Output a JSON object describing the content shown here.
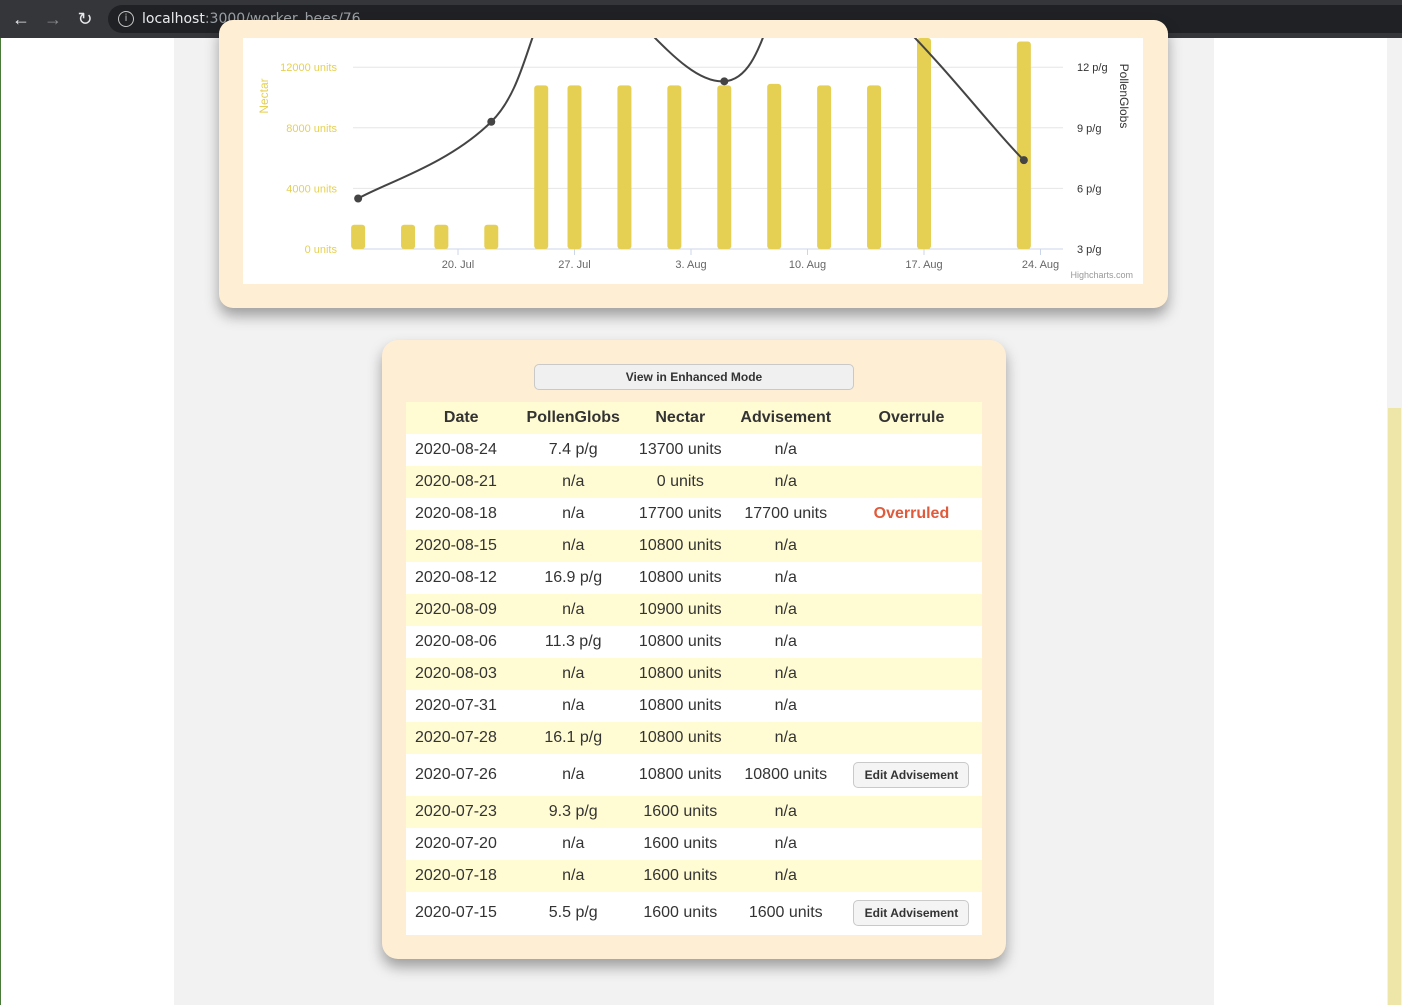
{
  "browser": {
    "url_host": "localhost",
    "url_path": ":3000/worker_bees/76",
    "back_icon": "arrow-left-icon",
    "forward_icon": "arrow-right-icon",
    "reload_icon": "reload-icon",
    "info_icon": "info-icon"
  },
  "colors": {
    "bar": "#e5d053",
    "line": "#444444",
    "nectar_axis": "#e5d053",
    "overruled": "#e05a3c",
    "card": "#feeed3",
    "stripe": "#fffbd2"
  },
  "chart_data": {
    "type": "bar",
    "title": "",
    "credit": "Highcharts.com",
    "x_ticks": [
      "20. Jul",
      "27. Jul",
      "3. Aug",
      "10. Aug",
      "17. Aug",
      "24. Aug"
    ],
    "x_tick_dates": [
      "2020-07-20",
      "2020-07-27",
      "2020-08-03",
      "2020-08-10",
      "2020-08-17",
      "2020-08-24"
    ],
    "left_axis": {
      "title": "Nectar",
      "ticks": [
        "0 units",
        "4000 units",
        "8000 units",
        "12000 units"
      ],
      "tick_values": [
        0,
        4000,
        8000,
        12000
      ]
    },
    "right_axis": {
      "title": "PollenGlobs",
      "ticks": [
        "3 p/g",
        "6 p/g",
        "9 p/g",
        "12 p/g"
      ],
      "tick_values": [
        3,
        6,
        9,
        12
      ]
    },
    "series": [
      {
        "name": "Nectar",
        "type": "column",
        "points": [
          {
            "x": "2020-07-14",
            "y": 1600
          },
          {
            "x": "2020-07-17",
            "y": 1600
          },
          {
            "x": "2020-07-19",
            "y": 1600
          },
          {
            "x": "2020-07-22",
            "y": 1600
          },
          {
            "x": "2020-07-25",
            "y": 10800
          },
          {
            "x": "2020-07-27",
            "y": 10800
          },
          {
            "x": "2020-07-30",
            "y": 10800
          },
          {
            "x": "2020-08-02",
            "y": 10800
          },
          {
            "x": "2020-08-05",
            "y": 10800
          },
          {
            "x": "2020-08-08",
            "y": 10900
          },
          {
            "x": "2020-08-11",
            "y": 10800
          },
          {
            "x": "2020-08-14",
            "y": 10800
          },
          {
            "x": "2020-08-17",
            "y": 17700
          },
          {
            "x": "2020-08-23",
            "y": 13700
          }
        ]
      },
      {
        "name": "PollenGlobs",
        "type": "spline",
        "points": [
          {
            "x": "2020-07-14",
            "y": 5.5
          },
          {
            "x": "2020-07-22",
            "y": 9.3
          },
          {
            "x": "2020-07-27",
            "y": 16.1
          },
          {
            "x": "2020-08-05",
            "y": 11.3
          },
          {
            "x": "2020-08-11",
            "y": 16.9
          },
          {
            "x": "2020-08-23",
            "y": 7.4
          }
        ]
      }
    ]
  },
  "table_card": {
    "enhanced_button": "View in Enhanced Mode",
    "headers": [
      "Date",
      "PollenGlobs",
      "Nectar",
      "Advisement",
      "Overrule"
    ],
    "rows": [
      {
        "date": "2020-08-24",
        "pollen": "7.4 p/g",
        "nectar": "13700 units",
        "advisement": "n/a",
        "overrule": ""
      },
      {
        "date": "2020-08-21",
        "pollen": "n/a",
        "nectar": "0 units",
        "advisement": "n/a",
        "overrule": ""
      },
      {
        "date": "2020-08-18",
        "pollen": "n/a",
        "nectar": "17700 units",
        "advisement": "17700 units",
        "overrule": "Overruled"
      },
      {
        "date": "2020-08-15",
        "pollen": "n/a",
        "nectar": "10800 units",
        "advisement": "n/a",
        "overrule": ""
      },
      {
        "date": "2020-08-12",
        "pollen": "16.9 p/g",
        "nectar": "10800 units",
        "advisement": "n/a",
        "overrule": ""
      },
      {
        "date": "2020-08-09",
        "pollen": "n/a",
        "nectar": "10900 units",
        "advisement": "n/a",
        "overrule": ""
      },
      {
        "date": "2020-08-06",
        "pollen": "11.3 p/g",
        "nectar": "10800 units",
        "advisement": "n/a",
        "overrule": ""
      },
      {
        "date": "2020-08-03",
        "pollen": "n/a",
        "nectar": "10800 units",
        "advisement": "n/a",
        "overrule": ""
      },
      {
        "date": "2020-07-31",
        "pollen": "n/a",
        "nectar": "10800 units",
        "advisement": "n/a",
        "overrule": ""
      },
      {
        "date": "2020-07-28",
        "pollen": "16.1 p/g",
        "nectar": "10800 units",
        "advisement": "n/a",
        "overrule": ""
      },
      {
        "date": "2020-07-26",
        "pollen": "n/a",
        "nectar": "10800 units",
        "advisement": "10800 units",
        "overrule": "Edit Advisement"
      },
      {
        "date": "2020-07-23",
        "pollen": "9.3 p/g",
        "nectar": "1600 units",
        "advisement": "n/a",
        "overrule": ""
      },
      {
        "date": "2020-07-20",
        "pollen": "n/a",
        "nectar": "1600 units",
        "advisement": "n/a",
        "overrule": ""
      },
      {
        "date": "2020-07-18",
        "pollen": "n/a",
        "nectar": "1600 units",
        "advisement": "n/a",
        "overrule": ""
      },
      {
        "date": "2020-07-15",
        "pollen": "5.5 p/g",
        "nectar": "1600 units",
        "advisement": "1600 units",
        "overrule": "Edit Advisement"
      }
    ]
  }
}
